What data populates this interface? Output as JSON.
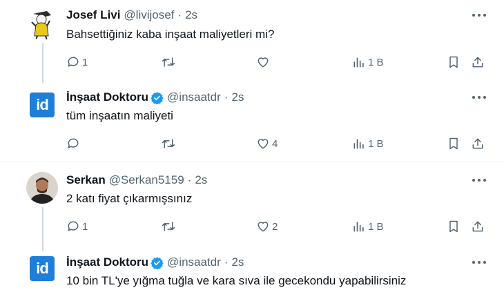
{
  "tweets": [
    {
      "name": "Josef Livi",
      "handle": "@livijosef",
      "time": "2s",
      "verified": false,
      "text": "Bahsettiğiniz kaba inşaat maliyetleri mi?",
      "replies": "1",
      "retweets": "",
      "likes": "",
      "views": "1 B"
    },
    {
      "name": "İnşaat Doktoru",
      "handle": "@insaatdr",
      "time": "2s",
      "verified": true,
      "avatar_text": "id",
      "text": "tüm inşaatın maliyeti",
      "replies": "",
      "retweets": "",
      "likes": "4",
      "views": "1 B"
    },
    {
      "name": "Serkan",
      "handle": "@Serkan5159",
      "time": "2s",
      "verified": false,
      "text": "2 katı fiyat çıkarmışsınız",
      "replies": "1",
      "retweets": "",
      "likes": "2",
      "views": "1 B"
    },
    {
      "name": "İnşaat Doktoru",
      "handle": "@insaatdr",
      "time": "2s",
      "verified": true,
      "avatar_text": "id",
      "text": "10 bin TL'ye yığma tuğla ve kara sıva ile gecekondu yapabilirsiniz"
    }
  ],
  "colors": {
    "text": "#0f1419",
    "muted": "#536471",
    "verified": "#1d9bf0",
    "brand": "#1e7ed9",
    "thread_line": "#cfd9de"
  },
  "icons": [
    "reply-icon",
    "retweet-icon",
    "like-icon",
    "views-icon",
    "bookmark-icon",
    "share-icon",
    "more-icon",
    "verified-badge-icon"
  ]
}
